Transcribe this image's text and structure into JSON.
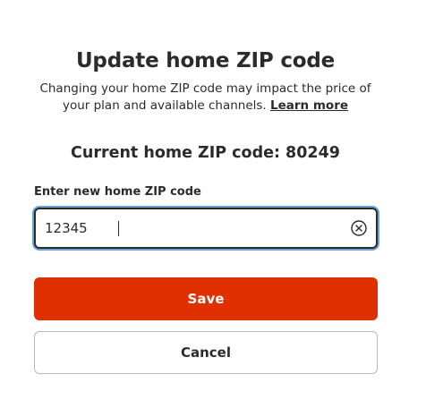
{
  "dialog": {
    "title": "Update home ZIP code",
    "description": "Changing your home ZIP code may impact the price of your plan and available channels.",
    "learn_more_label": "Learn more",
    "current_zip_label": "Current home ZIP code: 80249"
  },
  "zip_field": {
    "label": "Enter new home ZIP code",
    "value": "12345",
    "clear_icon": "clear-circle-x-icon"
  },
  "actions": {
    "save_label": "Save",
    "cancel_label": "Cancel"
  },
  "colors": {
    "primary": "#e03000",
    "text": "#2b2b2b",
    "focus_ring": "#6aa1d8",
    "border": "#b9b9b9"
  }
}
